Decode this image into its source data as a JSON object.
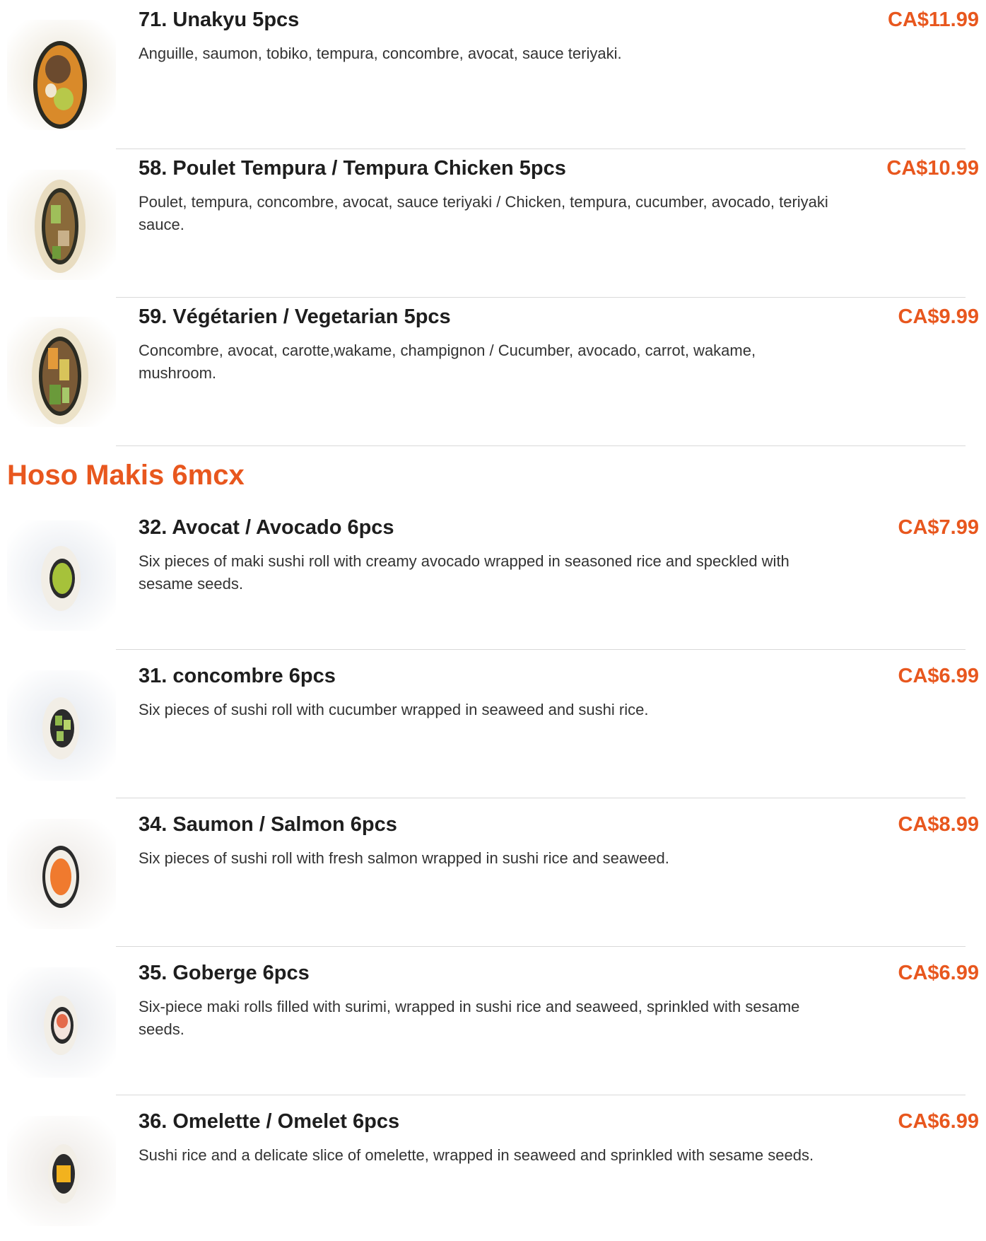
{
  "colors": {
    "accent": "#e8571e",
    "text": "#1e1e1e",
    "muted": "#333333",
    "divider": "#d9d9d9"
  },
  "top_items": [
    {
      "name": "71. Unakyu 5pcs",
      "price": "CA$11.99",
      "description": "Anguille, saumon, tobiko, tempura, concombre, avocat, sauce teriyaki.",
      "image_icon": "eel-roll-photo"
    },
    {
      "name": "58. Poulet Tempura / Tempura Chicken 5pcs",
      "price": "CA$10.99",
      "description": "Poulet, tempura, concombre, avocat, sauce teriyaki / Chicken, tempura, cucumber, avocado, teriyaki sauce.",
      "image_icon": "chicken-roll-photo"
    },
    {
      "name": "59. Végétarien / Vegetarian 5pcs",
      "price": "CA$9.99",
      "description": "Concombre, avocat, carotte,wakame, champignon / Cucumber, avocado, carrot, wakame, mushroom.",
      "image_icon": "vegetarian-roll-photo"
    }
  ],
  "section": {
    "title": "Hoso Makis 6mcx"
  },
  "section_items": [
    {
      "name": "32. Avocat / Avocado 6pcs",
      "price": "CA$7.99",
      "description": "Six pieces of maki sushi roll with creamy avocado wrapped in seasoned rice and speckled with sesame seeds.",
      "image_icon": "avocado-maki-photo"
    },
    {
      "name": "31. concombre 6pcs",
      "price": "CA$6.99",
      "description": "Six pieces of sushi roll with cucumber wrapped in seaweed and sushi rice.",
      "image_icon": "cucumber-maki-photo"
    },
    {
      "name": "34. Saumon / Salmon 6pcs",
      "price": "CA$8.99",
      "description": "Six pieces of sushi roll with fresh salmon wrapped in sushi rice and seaweed.",
      "image_icon": "salmon-maki-photo"
    },
    {
      "name": "35. Goberge 6pcs",
      "price": "CA$6.99",
      "description": "Six-piece maki rolls filled with surimi, wrapped in sushi rice and seaweed, sprinkled with sesame seeds.",
      "image_icon": "surimi-maki-photo"
    },
    {
      "name": "36. Omelette / Omelet 6pcs",
      "price": "CA$6.99",
      "description": "Sushi rice and a delicate slice of omelette, wrapped in seaweed and sprinkled with sesame seeds.",
      "image_icon": "omelet-maki-photo"
    }
  ]
}
